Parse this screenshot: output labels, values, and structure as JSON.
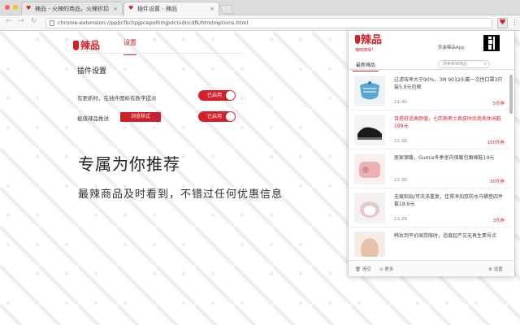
{
  "browser": {
    "tabs": [
      {
        "label": "辣品 - 火辣的商品，火辣折扣"
      },
      {
        "label": "插件设置 - 辣品"
      }
    ],
    "url": "chrome-extension://ppbcfkchpjpcepolhmjpdcnidncdfk/html/options.html"
  },
  "options": {
    "logo_text": "辣品",
    "nav_settings": "设置",
    "section_title": "插件设置",
    "rows": [
      {
        "label": "有更新时，在插件图标有数字提示",
        "toggle": "已启用"
      },
      {
        "label": "截值辣品推送",
        "button": "浏览样式",
        "toggle": "已启用"
      }
    ],
    "hero_title": "专属为你推荐",
    "hero_subtitle": "最辣商品及时看到，不错过任何优惠信息"
  },
  "popup": {
    "brand": "辣品",
    "slogan": "辣味搜得！",
    "install_app": "安装辣品App",
    "tab_latest": "最新辣品",
    "search_placeholder": "搜索新鲜辣品",
    "items": [
      {
        "title": "过滤效率大于90%，3M 9032头戴一次性口罩3只装5.9元包邮",
        "time": "11:40",
        "coupon": "5元券",
        "red": false
      },
      {
        "title": "百搭舒适高颜值，七匹狼男士真皮时尚商务休闲鞋199元",
        "time": "11:38",
        "coupon": "150元券",
        "red": true
      },
      {
        "title": "居家保暖，Gumia冬季室内保暖包跟棉鞋19元",
        "time": "11:30",
        "coupon": "30元券",
        "red": false
      },
      {
        "title": "无痕粘贴/可洗涤重复，佳得净加厚防水马桶垫四件套18.9元",
        "time": "11:29",
        "coupon": "3元券",
        "red": false
      },
      {
        "title": "韩妆到平价国货限时，适度起严又无再生素导点",
        "time": "",
        "coupon": "",
        "red": false
      }
    ],
    "footer": {
      "clear": "清空",
      "more": "更多",
      "settings": "设置"
    }
  },
  "colors": {
    "accent": "#d4202b"
  }
}
